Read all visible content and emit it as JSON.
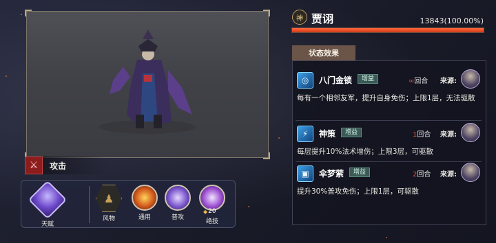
{
  "hero": {
    "rank": "神",
    "name": "贾诩",
    "hp_text": "13843(100.00%)",
    "hp_fraction": 1.0
  },
  "status": {
    "tab_label": "状态效果",
    "effects": [
      {
        "name": "八门金锁",
        "tag": "增益",
        "rounds_num": "∞",
        "rounds_unit": "回合",
        "source_label": "来源:",
        "description": "每有一个相邻友军，提升自身免伤；上限1层，无法驱散",
        "icon": "lock-ring-icon"
      },
      {
        "name": "神策",
        "tag": "增益",
        "rounds_num": "1",
        "rounds_unit": "回合",
        "source_label": "来源:",
        "description": "每层提升10%法术增伤；上限3层，可驱散",
        "icon": "lightning-icon"
      },
      {
        "name": "伞梦萦",
        "tag": "增益",
        "rounds_num": "2",
        "rounds_unit": "回合",
        "source_label": "来源:",
        "description": "提升30%普攻免伤；上限1层，可驱散",
        "icon": "cube-icon"
      }
    ]
  },
  "attack": {
    "label": "攻击",
    "icon": "sword-icon"
  },
  "skills": {
    "talent": "天赋",
    "fengwu": "风物",
    "tongyong": "通用",
    "pugong": "普攻",
    "jueji": "绝技",
    "energy": "20"
  },
  "colors": {
    "hp": "#d23a18",
    "rounds_accent": "#e2553c",
    "buff_tag": "#3a5a55"
  }
}
